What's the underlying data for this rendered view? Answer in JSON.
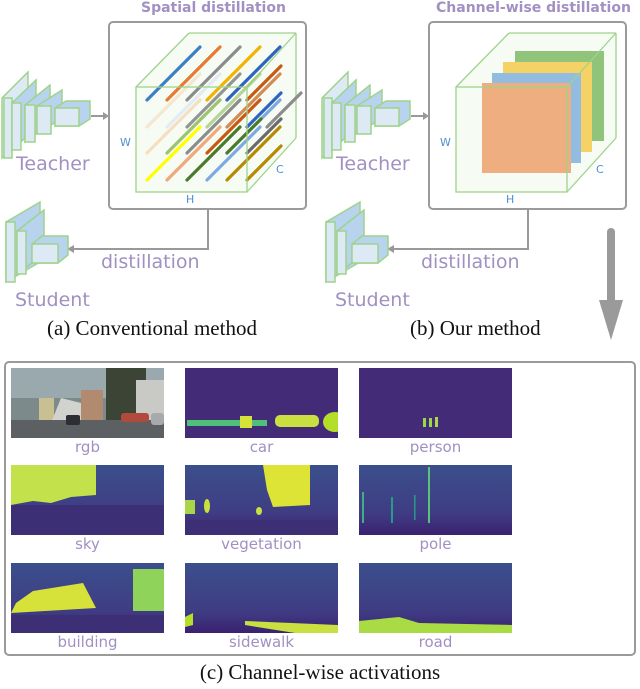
{
  "panel_a": {
    "title": "Spatial distillation",
    "teacher_label": "Teacher",
    "student_label": "Student",
    "arrow_label": "distillation",
    "axis_w": "W",
    "axis_h": "H",
    "axis_c": "C",
    "caption": "(a) Conventional method",
    "line_colors": [
      "#3b7fc4",
      "#e87a30",
      "#8c8c8c",
      "#f2b300",
      "#2e64c0",
      "#f5dfc0",
      "#dce6f2",
      "#6a6a6a",
      "#9cc46e",
      "#c85a10",
      "#ffff00",
      "#f0a878",
      "#4a7a2a",
      "#7ea8e0",
      "#b58a00"
    ]
  },
  "panel_b": {
    "title": "Channel-wise distillation",
    "teacher_label": "Teacher",
    "student_label": "Student",
    "arrow_label": "distillation",
    "axis_w": "W",
    "axis_h": "H",
    "axis_c": "C",
    "caption": "(b) Our method",
    "channel_colors": [
      "#8fc47a",
      "#f5d265",
      "#93bde0",
      "#eeae7f"
    ]
  },
  "panel_c": {
    "caption": "(c) Channel-wise activations",
    "maps": [
      {
        "label": "rgb"
      },
      {
        "label": "car"
      },
      {
        "label": "person"
      },
      {
        "label": "sky"
      },
      {
        "label": "vegetation"
      },
      {
        "label": "pole"
      },
      {
        "label": "building"
      },
      {
        "label": "sidewalk"
      },
      {
        "label": "road"
      }
    ]
  },
  "colors": {
    "cube_edge": "#9fd38a",
    "layer_fill": "#dde9f5",
    "layer_side": "#b7d3ee",
    "arrow": "#999999",
    "viridis_low": "#3f1f6e",
    "viridis_mid": "#2d6f8e",
    "viridis_high": "#e6e520"
  }
}
